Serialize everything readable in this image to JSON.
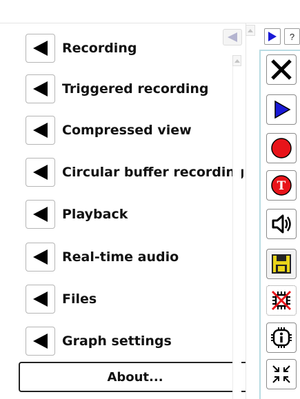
{
  "menu": {
    "items": [
      {
        "label": "Recording"
      },
      {
        "label": "Triggered recording"
      },
      {
        "label": "Compressed view"
      },
      {
        "label": "Circular buffer recording"
      },
      {
        "label": "Playback"
      },
      {
        "label": "Real-time audio"
      },
      {
        "label": "Files"
      },
      {
        "label": "Graph settings"
      }
    ],
    "about_label": "About..."
  },
  "toolbar_top": {
    "help_label": "?"
  },
  "toolbar": {
    "buttons": [
      {
        "icon": "close-x-icon"
      },
      {
        "icon": "play-icon"
      },
      {
        "icon": "record-icon"
      },
      {
        "icon": "triggered-record-icon",
        "label": "T"
      },
      {
        "icon": "speaker-icon"
      },
      {
        "icon": "save-icon"
      },
      {
        "icon": "chip-disabled-icon"
      },
      {
        "icon": "info-chip-icon"
      },
      {
        "icon": "collapse-arrows-icon"
      }
    ]
  },
  "colors": {
    "record_red": "#e8141a",
    "play_blue": "#1a1ad6",
    "save_yellow": "#e8d41a",
    "panel_border": "#b9dce3"
  }
}
